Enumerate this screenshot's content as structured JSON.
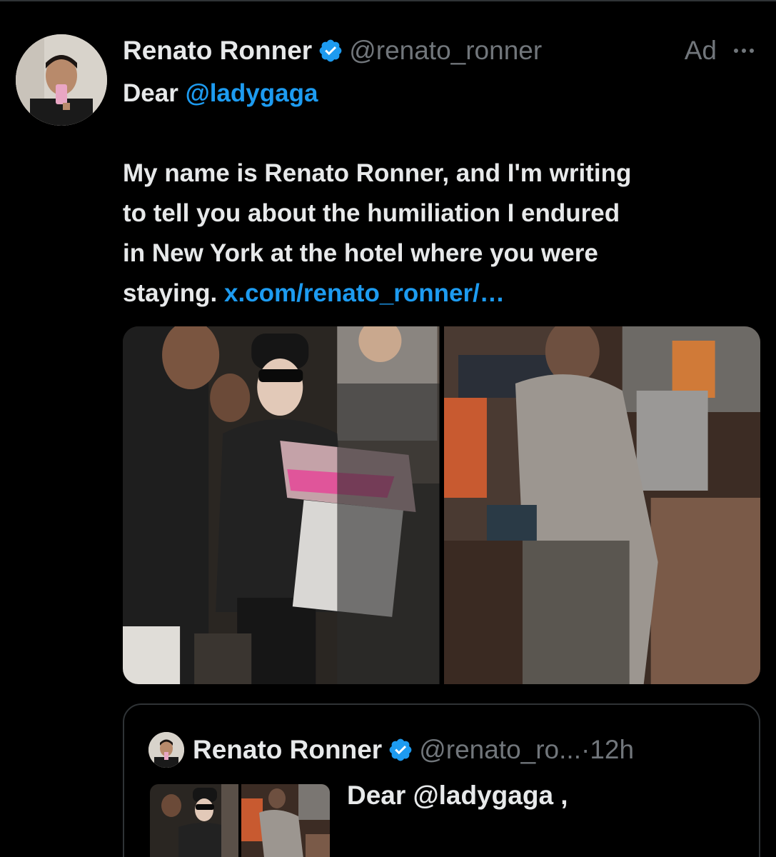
{
  "tweet": {
    "display_name": "Renato Ronner",
    "handle": "@renato_ronner",
    "ad_label": "Ad",
    "more_glyph": "···",
    "line1_prefix": "Dear ",
    "line1_mention": "@ladygaga",
    "body_lines": [
      "My name is Renato Ronner, and I'm writing",
      "to tell you about the humiliation I endured",
      "in New York at the hotel where you were"
    ],
    "last_line_prefix": "staying. ",
    "link_text": "x.com/renato_ronner/…",
    "media": [
      {
        "alt": "photo-celebrity-signing-autographs"
      },
      {
        "alt": "photo-man-at-hotel-desk"
      }
    ]
  },
  "quoted": {
    "display_name": "Renato Ronner",
    "handle": "@renato_ro...",
    "separator": " · ",
    "time": "12h",
    "text": "Dear @ladygaga ,"
  },
  "colors": {
    "background": "#000000",
    "text": "#e7e9ea",
    "secondary": "#71767b",
    "link": "#1d9bf0",
    "border": "#2f3336"
  },
  "icons": {
    "verified": "verified-badge-icon",
    "more": "more-horizontal-icon"
  }
}
